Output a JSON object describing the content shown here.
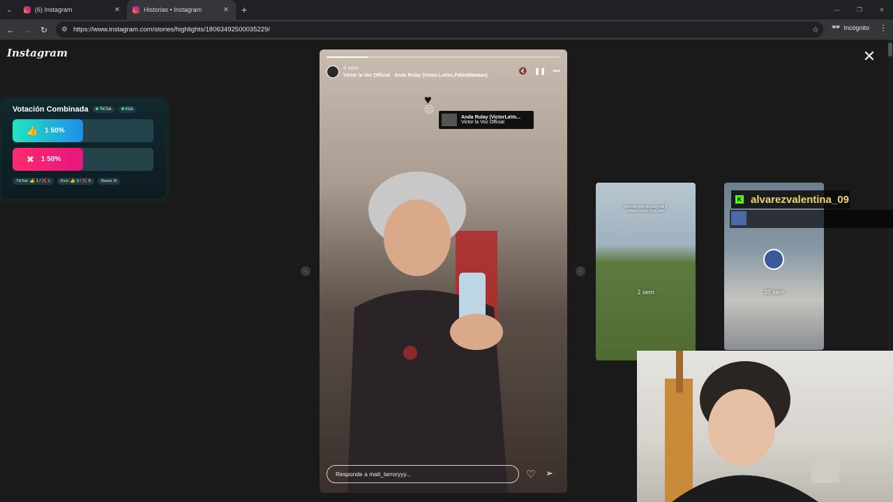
{
  "browser": {
    "tabs": [
      {
        "title": "(6) Instagram",
        "active": false
      },
      {
        "title": "Historias • Instagram",
        "active": true
      }
    ],
    "url": "https://www.instagram.com/stories/highlights/18063492500035229/",
    "incognito_label": "Incógnito"
  },
  "instagram": {
    "logo": "Instagram",
    "story": {
      "time": "4 sem",
      "music": "Victor la Voz Official · Anda Rulay (Victor.LaVoz,PabloMatatan)",
      "sticker_title": "Anda Rulay (VictorLaVo...",
      "sticker_artist": "Victor la Voz Official",
      "reply_placeholder": "Responde a mati_larroryyy...",
      "progress": 0.18
    },
    "previews": [
      {
        "time": "2 sem",
        "caption": "And she love the way I do it when I'm in it (Ooh, ah)"
      },
      {
        "time": "38 sem"
      }
    ]
  },
  "vote_overlay": {
    "title": "Votación Combinada",
    "platforms": [
      "TikTok",
      "Kick"
    ],
    "options": [
      {
        "label": "1  50%",
        "percent": 50,
        "color": "#22e5c0"
      },
      {
        "label": "1  50%",
        "percent": 50,
        "color": "#ff2a6e"
      }
    ],
    "footer": [
      "TikTok: 👍 1 / ❌ 1",
      "Kick: 👍 0 / ❌ 0",
      "Reset: R"
    ]
  },
  "stream_overlay": {
    "kick_username": "alvarezvalentina_09"
  }
}
